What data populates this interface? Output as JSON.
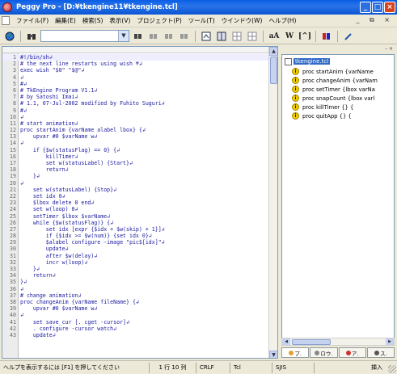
{
  "window": {
    "title": "Peggy Pro - [D:¥tkengine11¥tkengine.tcl]",
    "controls": [
      "_",
      "□",
      "×"
    ]
  },
  "menubar": {
    "items": [
      "ファイル(F)",
      "編集(E)",
      "検索(S)",
      "表示(V)",
      "プロジェクト(P)",
      "ツール(T)",
      "ウインドウ(W)",
      "ヘルプ(H)"
    ],
    "right_controls": "_ ⧉ ×"
  },
  "toolbar": {
    "search_value": "",
    "text_aa": "aA",
    "text_w": "W",
    "text_bracket": "[^]"
  },
  "editor": {
    "lines": [
      {
        "n": "1",
        "code": "#!/bin/sh↲"
      },
      {
        "n": "2",
        "code": "# the next line restarts using wish ¥↲"
      },
      {
        "n": "3",
        "code": "exec wish \"$0\" \"$@\"↲"
      },
      {
        "n": "4",
        "code": "↲"
      },
      {
        "n": "5",
        "code": "#↲"
      },
      {
        "n": "6",
        "code": "# TkEngine Program V1.1↲"
      },
      {
        "n": "7",
        "code": "# by Satoshi Imai↲"
      },
      {
        "n": "8",
        "code": "# 1.1, 07-Jul-2002 modified by Fuhito Suguri↲"
      },
      {
        "n": "9",
        "code": "#↲"
      },
      {
        "n": "10",
        "code": "↲"
      },
      {
        "n": "11",
        "code": "# start animation↲"
      },
      {
        "n": "12",
        "code": "proc startAnim {varName alabel lbox} {↲"
      },
      {
        "n": "13",
        "code": "    upvar #0 $varName w↲"
      },
      {
        "n": "14",
        "code": "↲"
      },
      {
        "n": "15",
        "code": "    if {$w(statusFlag) == 0} {↲"
      },
      {
        "n": "16",
        "code": "        killTimer↲"
      },
      {
        "n": "17",
        "code": "        set w(statusLabel) {Start}↲"
      },
      {
        "n": "18",
        "code": "        return↲"
      },
      {
        "n": "19",
        "code": "    }↲"
      },
      {
        "n": "20",
        "code": "↲"
      },
      {
        "n": "21",
        "code": "    set w(statusLabel) {Stop}↲"
      },
      {
        "n": "22",
        "code": "    set idx 0↲"
      },
      {
        "n": "23",
        "code": "    $lbox delete 0 end↲"
      },
      {
        "n": "24",
        "code": "    set w(loop) 0↲"
      },
      {
        "n": "25",
        "code": "    setTimer $lbox $varName↲"
      },
      {
        "n": "26",
        "code": "    while {$w(statusFlag)} {↲"
      },
      {
        "n": "27",
        "code": "        set idx [expr {$idx + $w(skip) + 1}]↲"
      },
      {
        "n": "28",
        "code": "        if {$idx >= $w(num)} {set idx 0}↲"
      },
      {
        "n": "29",
        "code": "        $alabel configure -image \"pic$[idx]\"↲"
      },
      {
        "n": "30",
        "code": "        update↲"
      },
      {
        "n": "31",
        "code": "        after $w(delay)↲"
      },
      {
        "n": "32",
        "code": "        incr w(loop)↲"
      },
      {
        "n": "33",
        "code": "    }↲"
      },
      {
        "n": "34",
        "code": "    return↲"
      },
      {
        "n": "35",
        "code": "}↲"
      },
      {
        "n": "36",
        "code": "↲"
      },
      {
        "n": "37",
        "code": "# change animation↲"
      },
      {
        "n": "38",
        "code": "proc changeAnim {varName fileName} {↲"
      },
      {
        "n": "39",
        "code": "    upvar #0 $varName w↲"
      },
      {
        "n": "40",
        "code": "↲"
      },
      {
        "n": "41",
        "code": "    set save_cur [. cget -cursor]↲"
      },
      {
        "n": "42",
        "code": "    . configure -cursor watch↲"
      },
      {
        "n": "43",
        "code": "    update↲"
      }
    ]
  },
  "outline": {
    "root": "tkengine.tcl",
    "items": [
      "proc startAnim {varName",
      "proc changeAnim {varNam",
      "proc setTimer {lbox varNa",
      "proc snapCount {lbox varl",
      "proc killTimer {} {",
      "proc quitApp {} {"
    ],
    "tabs": [
      "プ.",
      "ロウ.",
      "ア.",
      "ス."
    ]
  },
  "statusbar": {
    "help": "ヘルプを表示するには [F1] を押してください",
    "position": "1 行 10 列",
    "line_ending": "CRLF",
    "language": "Tcl",
    "encoding": "SJIS",
    "mode": "挿入"
  }
}
